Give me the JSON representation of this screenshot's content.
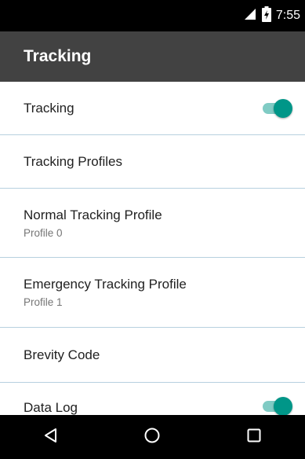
{
  "status_bar": {
    "time": "7:55",
    "icons": [
      "signal-icon",
      "battery-charging-icon"
    ]
  },
  "app_bar": {
    "title": "Tracking"
  },
  "settings": {
    "items": [
      {
        "title": "Tracking",
        "subtitle": "",
        "toggle": true
      },
      {
        "title": "Tracking Profiles",
        "subtitle": ""
      },
      {
        "title": "Normal Tracking Profile",
        "subtitle": "Profile 0"
      },
      {
        "title": "Emergency Tracking Profile",
        "subtitle": "Profile 1"
      },
      {
        "title": "Brevity Code",
        "subtitle": ""
      },
      {
        "title": "Data Log",
        "subtitle": "",
        "toggle": true
      }
    ]
  },
  "nav_bar": {
    "buttons": [
      "back-icon",
      "home-icon",
      "recents-icon"
    ]
  },
  "colors": {
    "app_bar": "#424242",
    "accent": "#009688",
    "accent_track": "#80cbc4",
    "divider": "#b7d0df"
  }
}
